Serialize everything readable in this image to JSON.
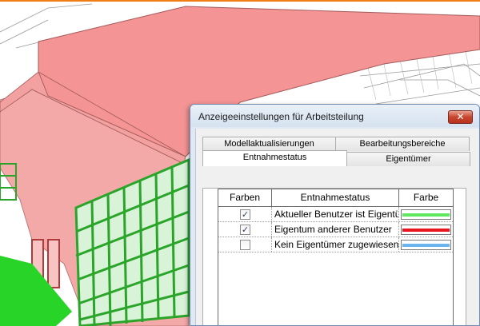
{
  "dialog": {
    "title": "Anzeigeeinstellungen für Arbeitsteilung",
    "close_label": "✕"
  },
  "tabs": {
    "back_row": [
      "Modellaktualisierungen",
      "Bearbeitungsbereiche"
    ],
    "front_row": [
      "Entnahmestatus",
      "Eigentümer"
    ],
    "active": "Entnahmestatus"
  },
  "table": {
    "headers": [
      "Farben",
      "Entnahmestatus",
      "Farbe"
    ],
    "rows": [
      {
        "checked": true,
        "check_mark": "✓",
        "status": "Aktueller Benutzer ist Eigentümer",
        "color": "#5fe85f"
      },
      {
        "checked": true,
        "check_mark": "✓",
        "status": "Eigentum anderer Benutzer",
        "color": "#e8151f"
      },
      {
        "checked": false,
        "check_mark": "",
        "status": "Kein Eigentümer zugewiesen",
        "color": "#6bb6f0"
      }
    ]
  },
  "colors": {
    "roof": "#f49494",
    "wall": "#f4a9a9",
    "window_green": "#3bbf3b",
    "accent_orange": "#ef7d14"
  }
}
